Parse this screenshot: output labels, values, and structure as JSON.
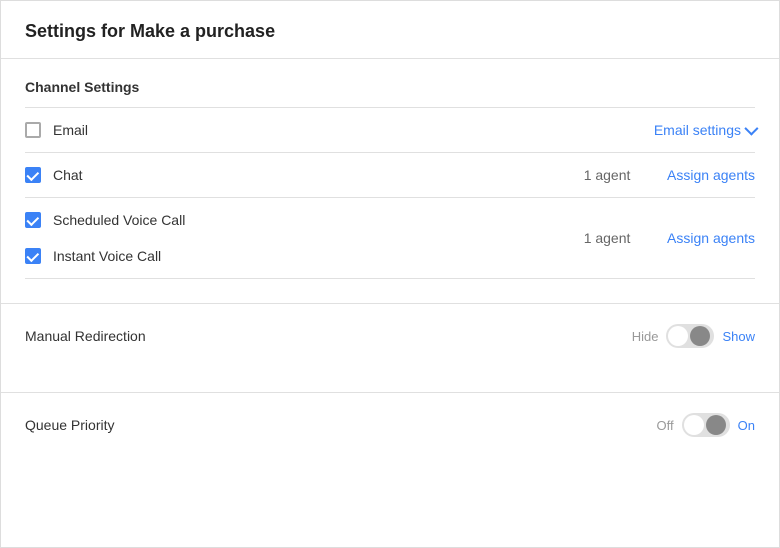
{
  "page": {
    "title": "Settings for Make a purchase"
  },
  "channel_settings": {
    "section_title": "Channel Settings",
    "channels": [
      {
        "id": "email",
        "name": "Email",
        "checked": false,
        "agent_count": null,
        "action_label": "Email settings",
        "action_type": "email_settings"
      },
      {
        "id": "chat",
        "name": "Chat",
        "checked": true,
        "agent_count": "1 agent",
        "action_label": "Assign agents",
        "action_type": "assign"
      }
    ],
    "voice_group": {
      "channels": [
        {
          "id": "scheduled_voice",
          "name": "Scheduled Voice Call",
          "checked": true
        },
        {
          "id": "instant_voice",
          "name": "Instant Voice Call",
          "checked": true
        }
      ],
      "agent_count": "1 agent",
      "action_label": "Assign agents",
      "action_type": "assign"
    }
  },
  "manual_redirection": {
    "label": "Manual Redirection",
    "left_label": "Hide",
    "right_label": "Show",
    "active_side": "show"
  },
  "queue_priority": {
    "label": "Queue Priority",
    "left_label": "Off",
    "right_label": "On",
    "active_side": "on"
  }
}
